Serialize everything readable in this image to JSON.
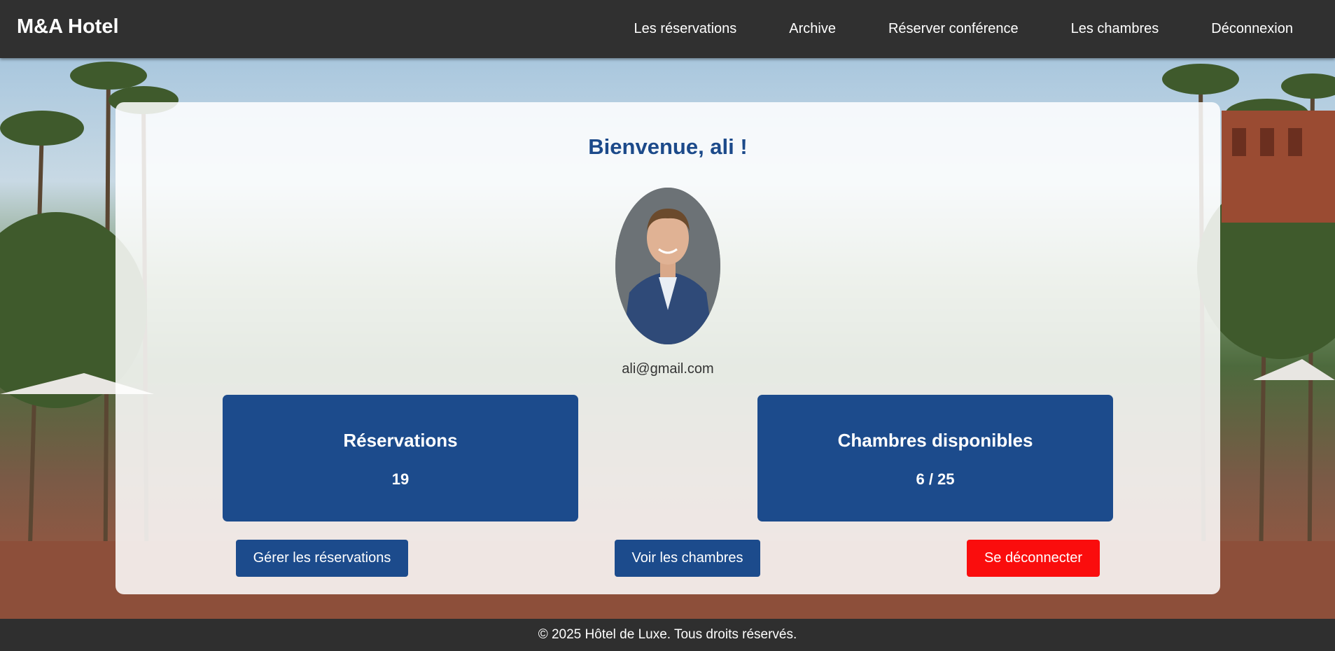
{
  "navbar": {
    "brand": "M&A Hotel",
    "links": [
      "Les réservations",
      "Archive",
      "Réserver conférence",
      "Les chambres",
      "Déconnexion"
    ]
  },
  "main": {
    "welcome": "Bienvenue, ali !",
    "email": "ali@gmail.com",
    "cards": [
      {
        "title": "Réservations",
        "value": "19"
      },
      {
        "title": "Chambres disponibles",
        "value": "6 / 25"
      }
    ],
    "buttons": {
      "manage": "Gérer les réservations",
      "rooms": "Voir les chambres",
      "logout": "Se déconnecter"
    }
  },
  "footer": {
    "text": "© 2025 Hôtel de Luxe. Tous droits réservés."
  },
  "colors": {
    "navbar": "#303030",
    "primary": "#1c4b8c",
    "danger": "#fa0d0d",
    "heading": "#1c4a8a"
  }
}
